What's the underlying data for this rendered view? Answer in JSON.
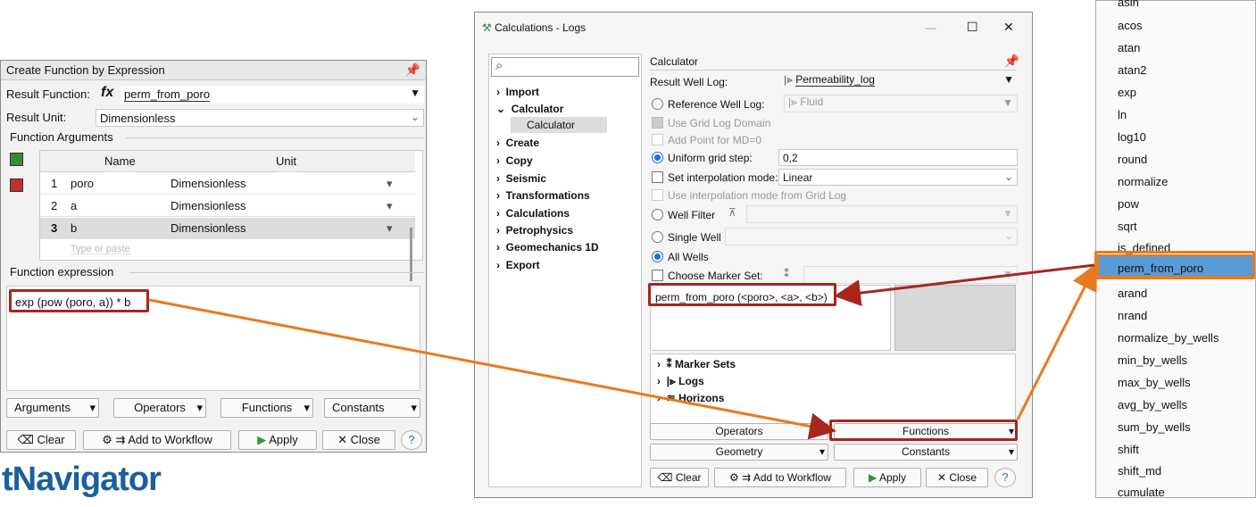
{
  "left_dialog": {
    "title": "Create Function by Expression",
    "result_function_label": "Result Function:",
    "fx_symbol": "fx",
    "result_function_value": "perm_from_poro",
    "result_unit_label": "Result Unit:",
    "result_unit_value": "Dimensionless",
    "args_group": "Function Arguments",
    "col_name": "Name",
    "col_unit": "Unit",
    "rows": [
      {
        "n": "1",
        "name": "poro",
        "unit": "Dimensionless"
      },
      {
        "n": "2",
        "name": "a",
        "unit": "Dimensionless"
      },
      {
        "n": "3",
        "name": "b",
        "unit": "Dimensionless"
      }
    ],
    "type_hint": "Type or paste",
    "expr_group": "Function expression",
    "expression": "exp (pow (poro, a)) * b",
    "tabs": [
      "Arguments",
      "Operators",
      "Functions",
      "Constants"
    ],
    "buttons": {
      "clear": "Clear",
      "add": "Add to Workflow",
      "apply": "Apply",
      "close": "Close"
    }
  },
  "calc_window": {
    "title": "Calculations - Logs",
    "search_placeholder": "",
    "tree": [
      "Import",
      "Calculator",
      "Calculator",
      "Create",
      "Copy",
      "Seismic",
      "Transformations",
      "Calculations",
      "Petrophysics",
      "Geomechanics 1D",
      "Export"
    ],
    "panel_title": "Calculator",
    "result_well_log_label": "Result Well Log:",
    "result_well_log_value": "Permeability_log",
    "reference_label": "Reference Well Log:",
    "reference_value": "Fluid",
    "use_grid": "Use Grid Log Domain",
    "add_point": "Add Point for MD=0",
    "uniform_label": "Uniform grid step:",
    "uniform_value": "0,2",
    "interp_label": "Set interpolation mode:",
    "interp_value": "Linear",
    "use_interp": "Use interpolation mode from Grid Log",
    "well_filter": "Well Filter",
    "single_well": "Single Well",
    "all_wells": "All Wells",
    "marker_set": "Choose Marker Set:",
    "expression": "perm_from_poro (<poro>, <a>, <b>)",
    "tree2": [
      "Marker Sets",
      "Logs",
      "Horizons"
    ],
    "btn_operators": "Operators",
    "btn_functions": "Functions",
    "btn_geometry": "Geometry",
    "btn_constants": "Constants",
    "buttons": {
      "clear": "Clear",
      "add": "Add to Workflow",
      "apply": "Apply",
      "close": "Close"
    }
  },
  "function_list": [
    "asin",
    "acos",
    "atan",
    "atan2",
    "exp",
    "ln",
    "log10",
    "round",
    "normalize",
    "pow",
    "sqrt",
    "is_defined",
    "perm_from_poro",
    "arand",
    "nrand",
    "normalize_by_wells",
    "min_by_wells",
    "max_by_wells",
    "avg_by_wells",
    "sum_by_wells",
    "shift",
    "shift_md",
    "cumulate"
  ],
  "logo": "tNavigator",
  "colors": {
    "accent_red": "#a8261c",
    "accent_orange": "#e87a20",
    "highlight": "#5b9bd5"
  }
}
